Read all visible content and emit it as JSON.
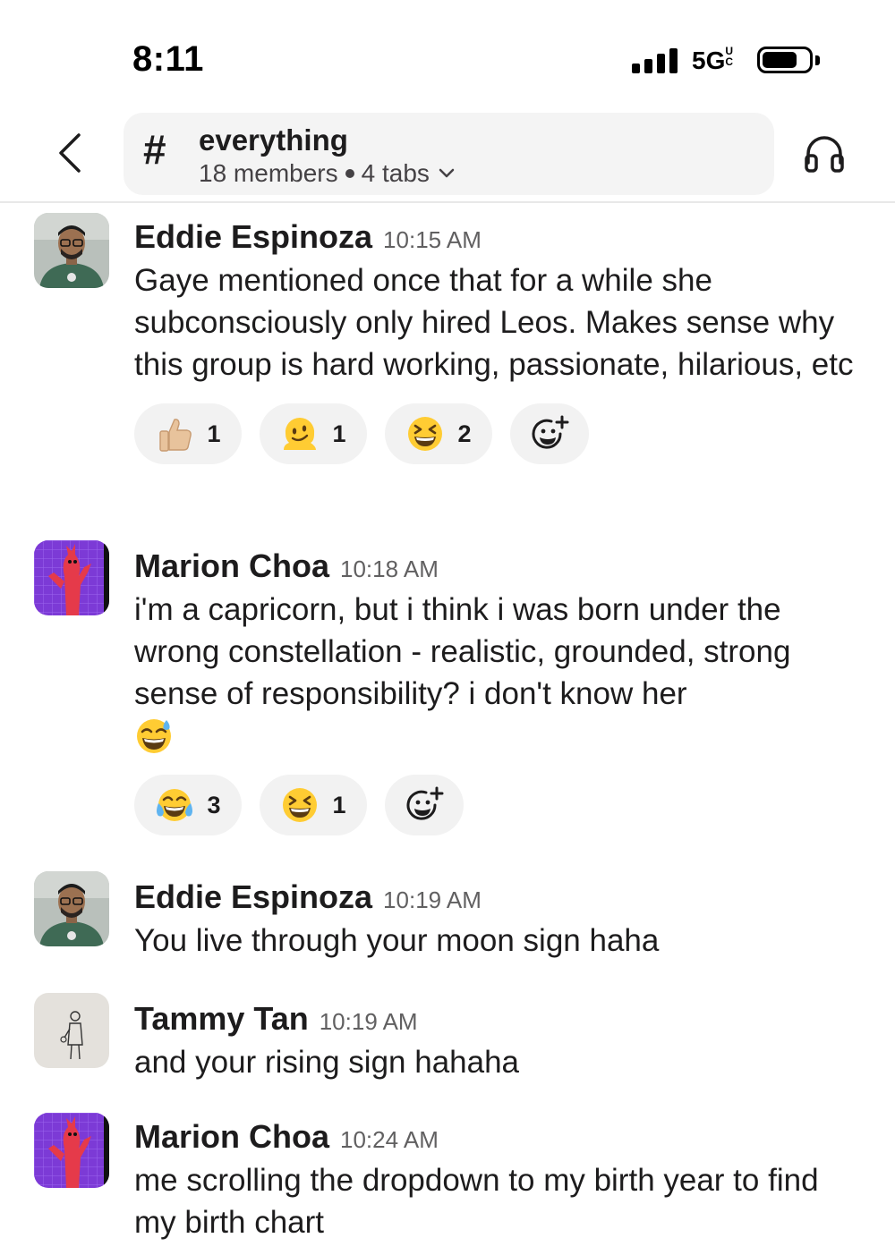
{
  "status_bar": {
    "time": "8:11",
    "network": "5G",
    "network_sub": "UC"
  },
  "header": {
    "channel_hash": "#",
    "channel_name": "everything",
    "members": "18 members",
    "tabs": "4 tabs"
  },
  "messages": [
    {
      "sender": "Eddie Espinoza",
      "time": "10:15 AM",
      "avatar": "man-with-glasses",
      "text": "Gaye mentioned once that for a while she subconsciously only hired Leos. Makes sense why this group is hard working, passionate, hilarious, etc",
      "reactions": [
        {
          "emoji": "thumbs-up",
          "count": "1"
        },
        {
          "emoji": "melting-face",
          "count": "1"
        },
        {
          "emoji": "squinting-grin",
          "count": "2"
        }
      ]
    },
    {
      "sender": "Marion Choa",
      "time": "10:18 AM",
      "avatar": "inflatable-tube-man",
      "text": "i'm a capricorn, but i think i was born under the wrong constellation - realistic, grounded, strong sense of responsibility? i don't know her",
      "trailing_emoji": "grinning-sweat",
      "reactions": [
        {
          "emoji": "tears-of-joy",
          "count": "3"
        },
        {
          "emoji": "squinting-grin",
          "count": "1"
        }
      ]
    },
    {
      "sender": "Eddie Espinoza",
      "time": "10:19 AM",
      "avatar": "man-with-glasses",
      "text": "You live through your moon sign haha"
    },
    {
      "sender": "Tammy Tan",
      "time": "10:19 AM",
      "avatar": "sketch-figure",
      "text": "and your rising sign hahaha"
    },
    {
      "sender": "Marion Choa",
      "time": "10:24 AM",
      "avatar": "inflatable-tube-man",
      "text": "me scrolling the dropdown to my birth year to find my birth chart"
    }
  ]
}
